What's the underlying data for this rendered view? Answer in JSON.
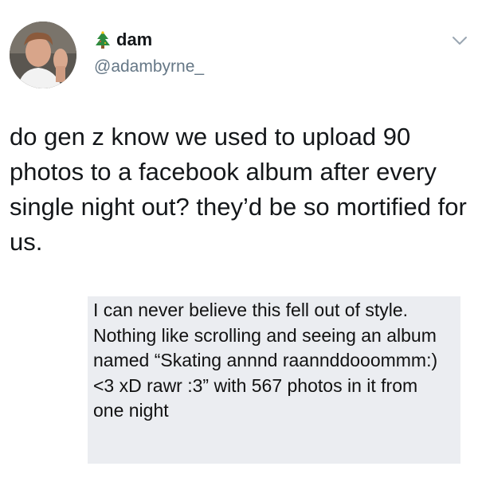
{
  "tweet": {
    "author": {
      "display_name": "dam",
      "handle": "@adambyrne_",
      "avatar_icon": "avatar-photo",
      "name_emoji_icon": "christmas-tree-icon"
    },
    "menu_icon": "chevron-down-icon",
    "text": "do gen z know we used to upload 90 photos to a facebook album after every single night out? they’d be so mortified for us."
  },
  "reply": {
    "text": "I can never believe this fell out of style. Nothing like scrolling and seeing an album named “Skating annnd raannddooommm:)<3 xD rawr :3” with 567 photos in it from one night",
    "background_color": "#ebedf1"
  },
  "colors": {
    "text": "#14171a",
    "secondary": "#657786"
  }
}
